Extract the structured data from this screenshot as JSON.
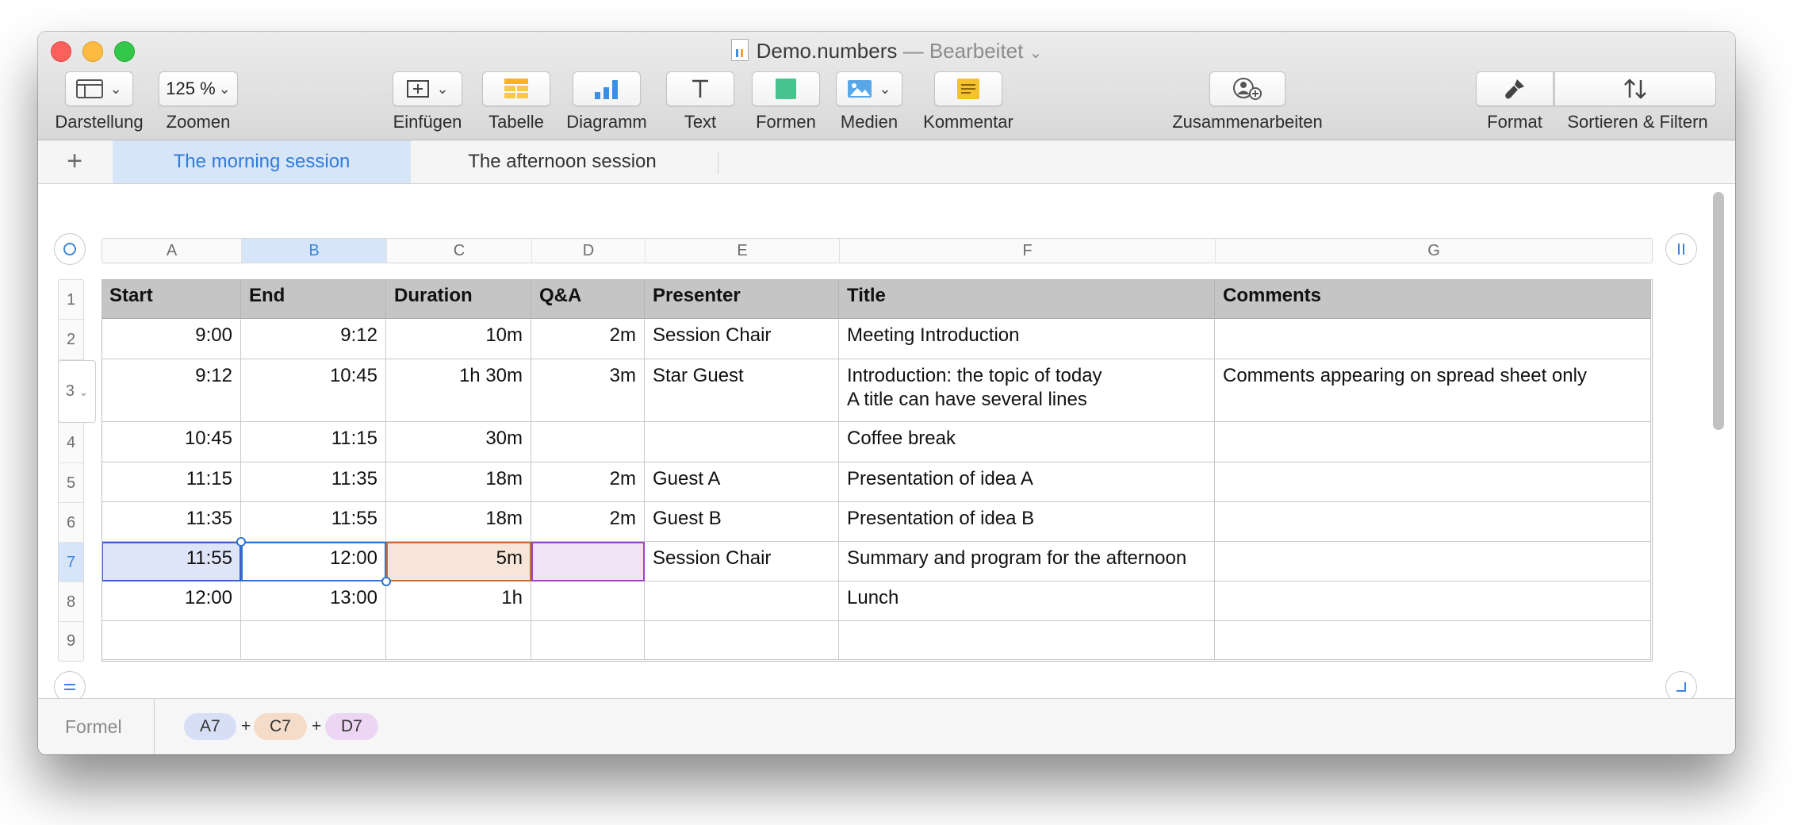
{
  "window": {
    "document_name": "Demo.numbers",
    "edited": "— Bearbeitet"
  },
  "toolbar": {
    "view_label": "Darstellung",
    "zoom_value": "125 %",
    "zoom_label": "Zoomen",
    "insert_label": "Einfügen",
    "table_label": "Tabelle",
    "chart_label": "Diagramm",
    "text_label": "Text",
    "shapes_label": "Formen",
    "media_label": "Medien",
    "comment_label": "Kommentar",
    "collaborate_label": "Zusammenarbeiten",
    "format_label": "Format",
    "sort_filter_label": "Sortieren & Filtern"
  },
  "sheets": {
    "add": "+",
    "tabs": [
      "The morning session",
      "The afternoon session"
    ],
    "active": 0
  },
  "columns": [
    "A",
    "B",
    "C",
    "D",
    "E",
    "F",
    "G"
  ],
  "selected_column": "B",
  "rows": [
    "1",
    "2",
    "3",
    "4",
    "5",
    "6",
    "7",
    "8",
    "9"
  ],
  "selected_row": "7",
  "table": {
    "headers": [
      "Start",
      "End",
      "Duration",
      "Q&A",
      "Presenter",
      "Title",
      "Comments"
    ],
    "rows": [
      [
        "9:00",
        "9:12",
        "10m",
        "2m",
        "Session Chair",
        "Meeting Introduction",
        ""
      ],
      [
        "9:12",
        "10:45",
        "1h 30m",
        "3m",
        "Star Guest",
        "Introduction: the topic of today\nA title can have several lines",
        "Comments appearing on spread sheet only"
      ],
      [
        "10:45",
        "11:15",
        "30m",
        "",
        "",
        "Coffee break",
        ""
      ],
      [
        "11:15",
        "11:35",
        "18m",
        "2m",
        "Guest A",
        "Presentation of idea A",
        ""
      ],
      [
        "11:35",
        "11:55",
        "18m",
        "2m",
        "Guest B",
        "Presentation of idea B",
        ""
      ],
      [
        "11:55",
        "12:00",
        "5m",
        "",
        "Session Chair",
        "Summary and program for the afternoon",
        ""
      ],
      [
        "12:00",
        "13:00",
        "1h",
        "",
        "",
        "Lunch",
        ""
      ],
      [
        "",
        "",
        "",
        "",
        "",
        "",
        ""
      ]
    ]
  },
  "formula_bar": {
    "label": "Formel",
    "tokens": [
      {
        "ref": "A7",
        "color": "#d6dff6"
      },
      {
        "ref": "C7",
        "color": "#f5dcc9"
      },
      {
        "ref": "D7",
        "color": "#ecd6f3"
      }
    ],
    "operator": "+"
  },
  "colors": {
    "accent": "#2f7bd8",
    "header_fill": "#c5c5c5",
    "a7_ref": "#3c60c9",
    "c7_ref": "#c76a33",
    "d7_ref": "#a043c0"
  }
}
